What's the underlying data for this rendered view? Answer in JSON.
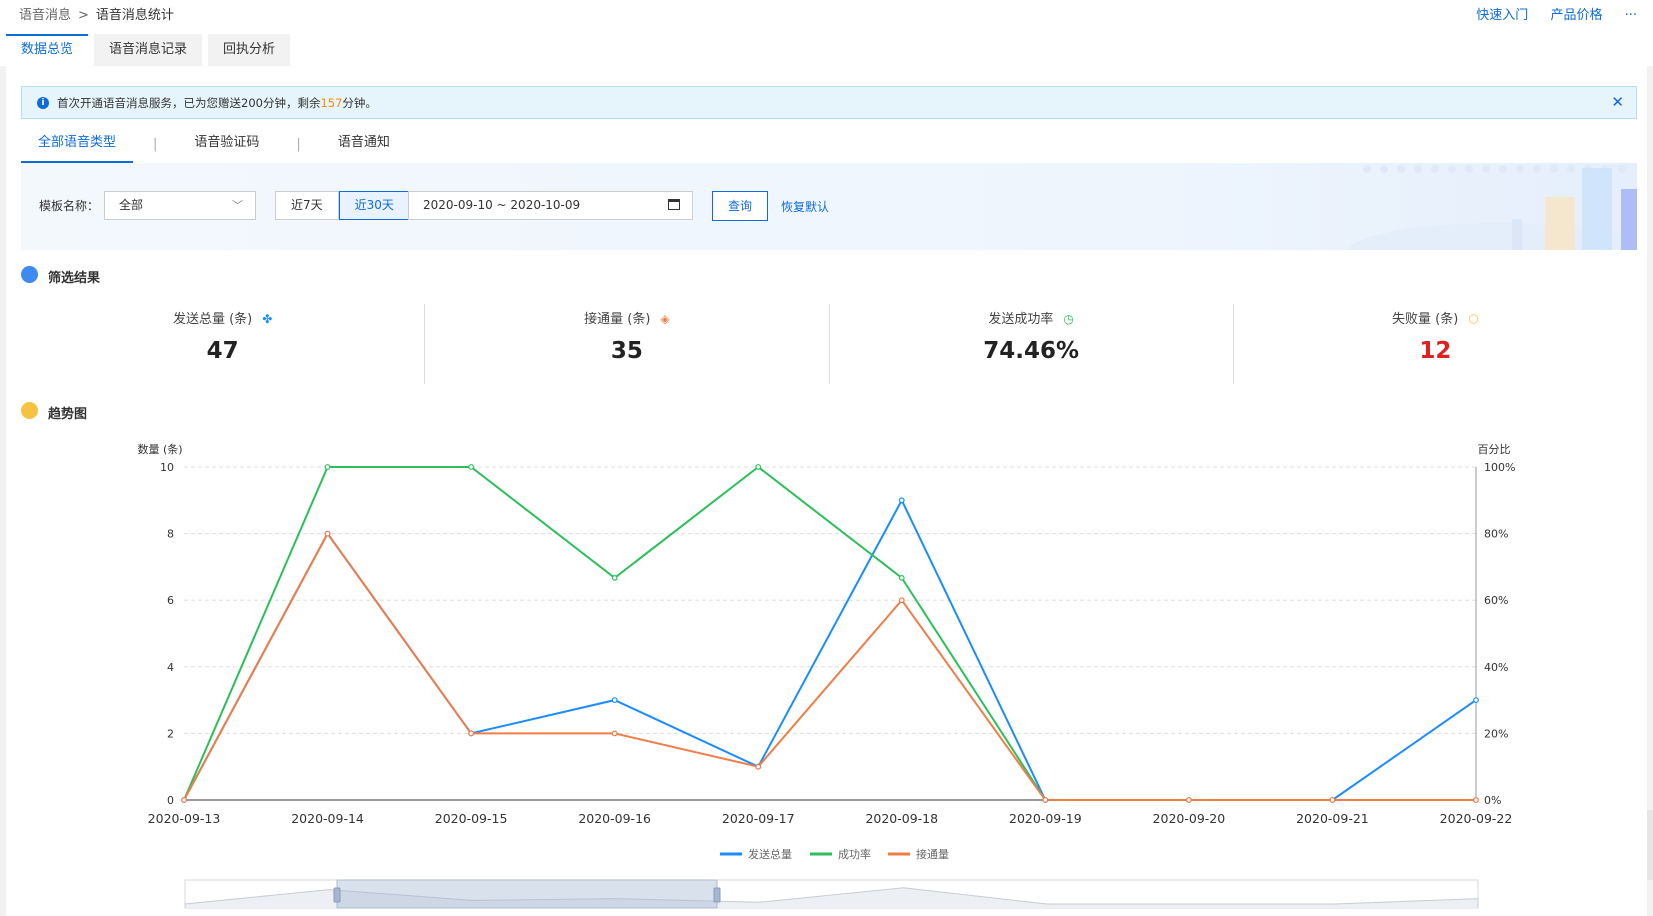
{
  "breadcrumb": {
    "parent": "语音消息",
    "separator": ">",
    "current": "语音消息统计"
  },
  "top_links": {
    "quickstart": "快速入门",
    "pricing": "产品价格",
    "more": "···"
  },
  "main_tabs": [
    {
      "label": "数据总览",
      "active": true
    },
    {
      "label": "语音消息记录",
      "active": false
    },
    {
      "label": "回执分析",
      "active": false
    }
  ],
  "notice": {
    "icon": "info-icon",
    "text_before": "首次开通语音消息服务，已为您赠送200分钟，剩余",
    "highlight": "157",
    "text_after": "分钟。",
    "close_icon": "close-icon"
  },
  "sub_tabs": [
    {
      "label": "全部语音类型",
      "active": true
    },
    {
      "label": "语音验证码",
      "active": false
    },
    {
      "label": "语音通知",
      "active": false
    }
  ],
  "filter": {
    "template_label": "模板名称：",
    "template_value": "全部",
    "range_buttons": [
      {
        "label": "近7天",
        "active": false
      },
      {
        "label": "近30天",
        "active": true
      }
    ],
    "date_range": "2020-09-10 ~ 2020-10-09",
    "query_label": "查询",
    "reset_label": "恢复默认"
  },
  "results_section": {
    "title": "筛选结果"
  },
  "stats": [
    {
      "label": "发送总量 (条)",
      "value": "47",
      "icon": "share-icon",
      "color": "#1a8cff",
      "red": false
    },
    {
      "label": "接通量 (条)",
      "value": "35",
      "icon": "layers-icon",
      "color": "#f07d47",
      "red": false
    },
    {
      "label": "发送成功率",
      "value": "74.46%",
      "icon": "clock-icon",
      "color": "#2bbf5a",
      "red": false
    },
    {
      "label": "失败量 (条)",
      "value": "12",
      "icon": "box-icon",
      "color": "#f5c242",
      "red": true
    }
  ],
  "trend_section": {
    "title": "趋势图"
  },
  "chart_data": {
    "type": "line",
    "ylabel_left": "数量 (条)",
    "ylabel_right": "百分比",
    "ylim_left": [
      0,
      10
    ],
    "ylim_right": [
      0,
      100
    ],
    "yticks_left": [
      "0",
      "2",
      "4",
      "6",
      "8",
      "10"
    ],
    "yticks_right": [
      "0%",
      "20%",
      "40%",
      "60%",
      "80%",
      "100%"
    ],
    "categories": [
      "2020-09-13",
      "2020-09-14",
      "2020-09-15",
      "2020-09-16",
      "2020-09-17",
      "2020-09-18",
      "2020-09-19",
      "2020-09-20",
      "2020-09-21",
      "2020-09-22"
    ],
    "grid": true,
    "legend_position": "bottom",
    "series": [
      {
        "name": "发送总量",
        "axis": "left",
        "color": "#1a8cff",
        "values": [
          0,
          8,
          2,
          3,
          1,
          9,
          0,
          0,
          0,
          3
        ]
      },
      {
        "name": "成功率",
        "axis": "right",
        "color": "#2bbf5a",
        "values": [
          0,
          100,
          100,
          66.7,
          100,
          66.7,
          0,
          0,
          0,
          0
        ]
      },
      {
        "name": "接通量",
        "axis": "left",
        "color": "#f07d47",
        "values": [
          0,
          8,
          2,
          2,
          1,
          6,
          0,
          0,
          0,
          0
        ]
      }
    ],
    "zoom_window": [
      "2020-09-13",
      "2020-09-22"
    ]
  }
}
